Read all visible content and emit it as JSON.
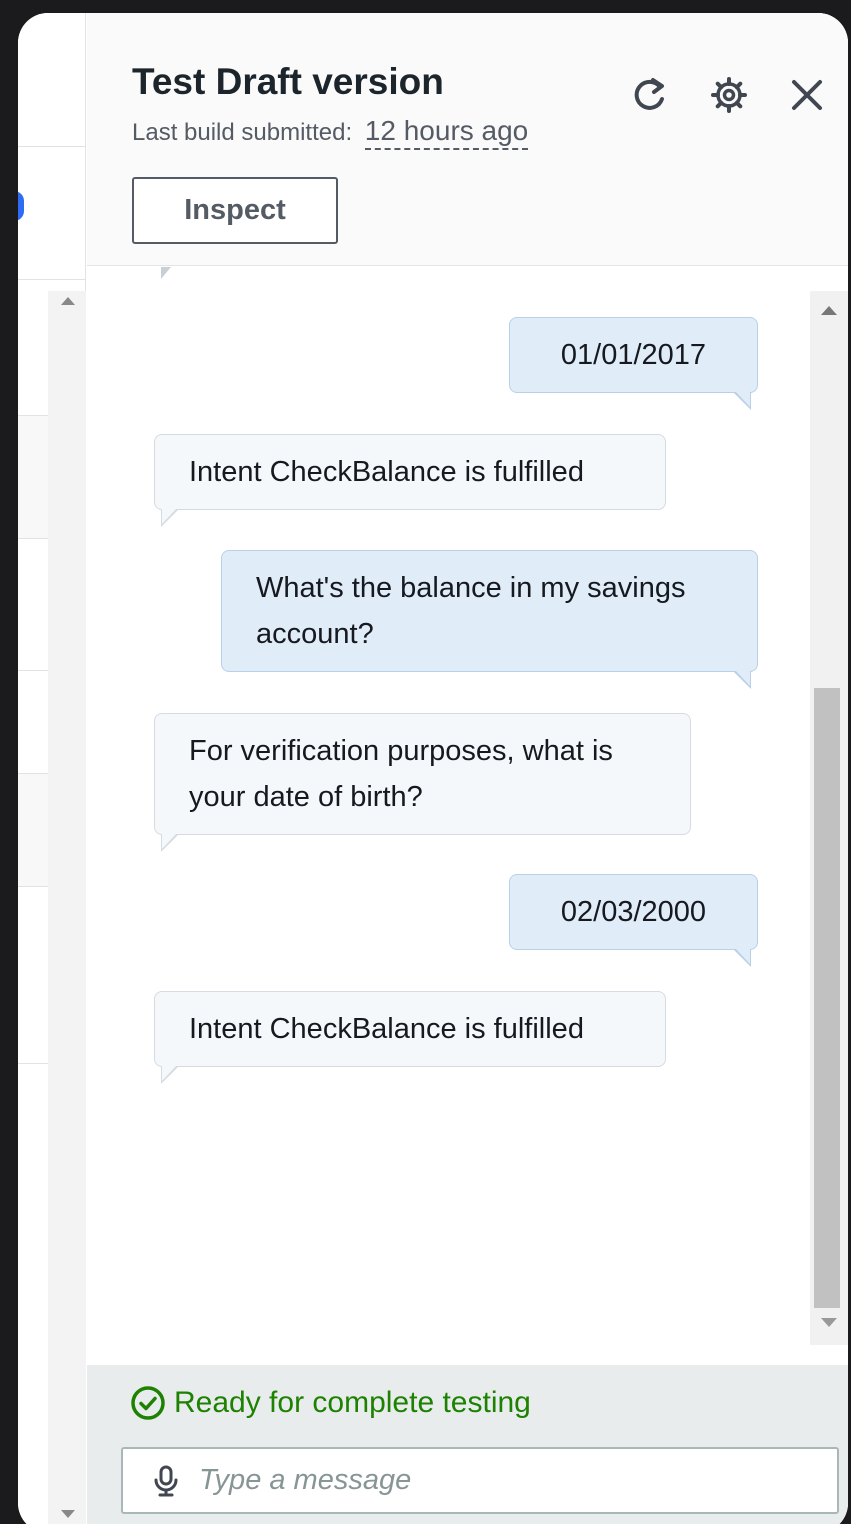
{
  "header": {
    "title": "Test Draft version",
    "subtitle_label": "Last build submitted:",
    "subtitle_value": "12 hours ago",
    "inspect_label": "Inspect",
    "icons": [
      "refresh-icon",
      "settings-icon",
      "close-icon"
    ]
  },
  "messages": [
    {
      "role": "user",
      "text": "01/01/2017"
    },
    {
      "role": "bot",
      "text": "Intent CheckBalance is fulfilled"
    },
    {
      "role": "user",
      "text": "What's the balance in my savings account?"
    },
    {
      "role": "bot",
      "text": "For verification purposes, what is your date of birth?"
    },
    {
      "role": "user",
      "text": "02/03/2000"
    },
    {
      "role": "bot",
      "text": "Intent CheckBalance is fulfilled"
    }
  ],
  "footer": {
    "status_text": "Ready for complete testing",
    "status_color": "#1d8102",
    "input_placeholder": "Type a message"
  },
  "colors": {
    "user_bubble": "#e0ecf8",
    "bot_bubble": "#f5f8fb",
    "accent_blue": "#2f6cf6"
  }
}
